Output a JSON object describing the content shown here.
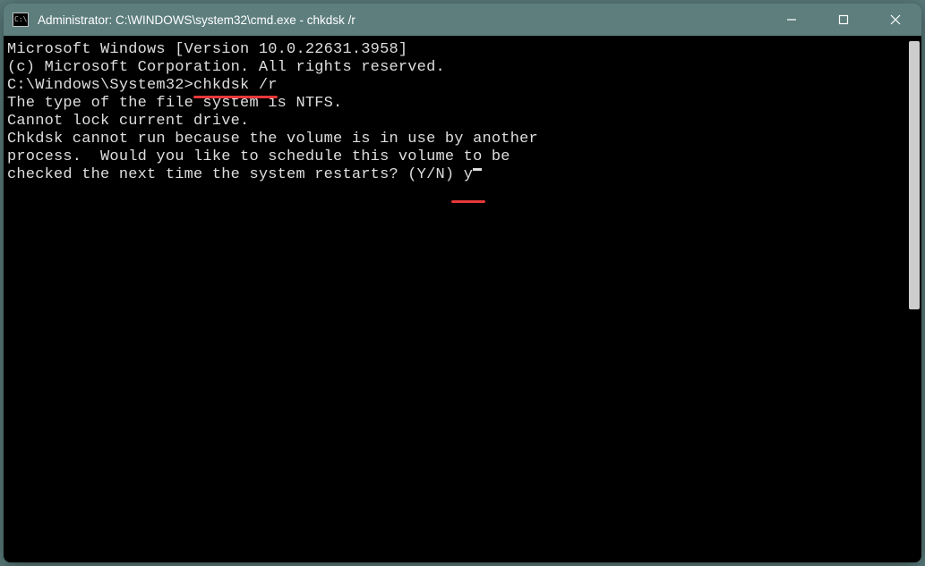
{
  "titlebar": {
    "icon_text": "C:\\",
    "title": "Administrator: C:\\WINDOWS\\system32\\cmd.exe - chkdsk  /r"
  },
  "terminal": {
    "line1": "Microsoft Windows [Version 10.0.22631.3958]",
    "line2": "(c) Microsoft Corporation. All rights reserved.",
    "blank1": "",
    "prompt_prefix": "C:\\Windows\\System32>",
    "command": "chkdsk /r",
    "line4": "The type of the file system is NTFS.",
    "line5": "Cannot lock current drive.",
    "blank2": "",
    "line6": "Chkdsk cannot run because the volume is in use by another",
    "line7": "process.  Would you like to schedule this volume to be",
    "line8_prefix": "checked the next time the system restarts? (Y/N) ",
    "line8_input": "y"
  }
}
